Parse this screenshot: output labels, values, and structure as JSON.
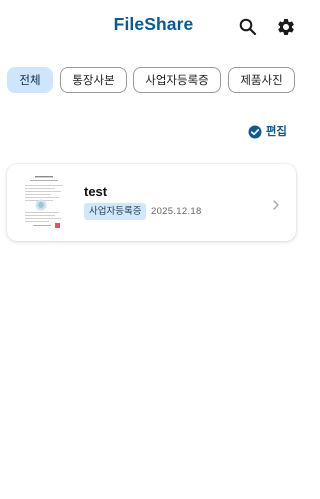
{
  "header": {
    "title": "FileShare",
    "search_icon": "search-icon",
    "settings_icon": "gear-icon",
    "accent_color": "#0d5a8c"
  },
  "filters": [
    {
      "label": "전체",
      "active": true
    },
    {
      "label": "통장사본",
      "active": false
    },
    {
      "label": "사업자등록증",
      "active": false
    },
    {
      "label": "제품사진",
      "active": false
    }
  ],
  "edit": {
    "label": "편집",
    "icon": "check-circle-icon"
  },
  "documents": [
    {
      "title": "test",
      "category": "사업자등록증",
      "date": "2025.12.18",
      "thumbnail_icon": "document-thumbnail",
      "chevron_icon": "chevron-right-icon"
    }
  ],
  "colors": {
    "chip_active_bg": "#cfe5fb",
    "tag_bg": "#d3e7fa"
  }
}
